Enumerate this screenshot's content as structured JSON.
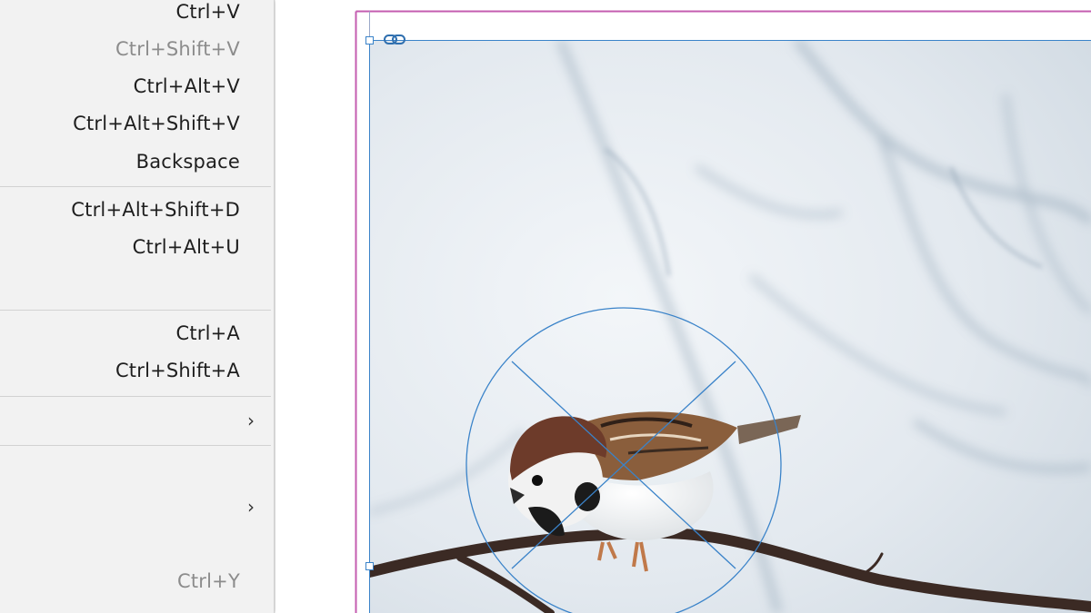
{
  "menu": {
    "items": [
      {
        "shortcut": "Ctrl+V",
        "disabled": false
      },
      {
        "shortcut": "Ctrl+Shift+V",
        "disabled": true
      },
      {
        "shortcut": "Ctrl+Alt+V",
        "disabled": false
      },
      {
        "shortcut": "Ctrl+Alt+Shift+V",
        "disabled": false
      },
      {
        "shortcut": "Backspace",
        "disabled": false
      },
      {
        "shortcut": "Ctrl+Alt+Shift+D",
        "disabled": false
      },
      {
        "shortcut": "Ctrl+Alt+U",
        "disabled": false
      },
      {
        "shortcut": "Ctrl+A",
        "disabled": false
      },
      {
        "shortcut": "Ctrl+Shift+A",
        "disabled": false
      },
      {
        "shortcut": "Ctrl+Y",
        "disabled": true
      }
    ],
    "submenu_icon": "chevron-right-icon"
  },
  "canvas": {
    "image_subject": "sparrow-on-branch-photo",
    "frame_link_icon": "link-chain-icon",
    "content_grabber_icon": "content-grabber-icon"
  },
  "colors": {
    "menu_background": "#f2f2f2",
    "margin_guide": "#c45cb0",
    "frame_selection": "#3a83c9"
  }
}
